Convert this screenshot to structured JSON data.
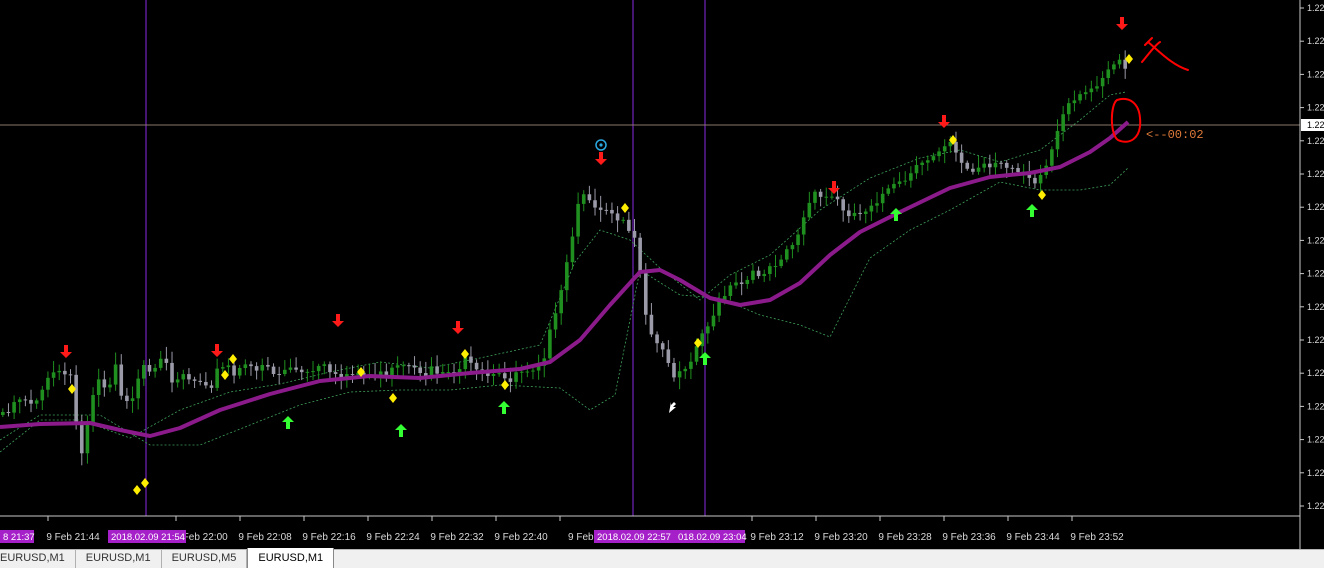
{
  "chart_data": {
    "type": "candlestick",
    "symbol": "EURUSD",
    "timeframe": "M1",
    "x_tick_labels": [
      "9 Feb 21:44",
      "9 Feb 22:00",
      "9 Feb 22:08",
      "9 Feb 22:16",
      "9 Feb 22:24",
      "9 Feb 22:32",
      "9 Feb 22:40",
      "9 Feb 2",
      "9 Feb 23:12",
      "9 Feb 23:20",
      "9 Feb 23:28",
      "9 Feb 23:36",
      "9 Feb 23:44",
      "9 Feb 23:52"
    ],
    "y_tick_labels": [
      "1.22",
      "1.22",
      "1.22",
      "1.22",
      "1.22",
      "1.22",
      "1.22",
      "1.22",
      "1.22",
      "1.22",
      "1.22",
      "1.22",
      "1.22",
      "1.22",
      "1.22",
      "1.22"
    ],
    "current_price_label": "1.22",
    "vertical_line_labels": [
      "8 21:37",
      "2018.02.09 21:54",
      "2018.02.09 22:57",
      "018.02.09 23:04"
    ],
    "countdown_label": "<--00:02",
    "colors": {
      "bull": "#1f8f1f",
      "bear": "#9a9aa8",
      "moving_average": "#8b1a8b",
      "envelope": "#3fa05a",
      "sell_arrow": "#ff1a1a",
      "buy_arrow": "#33ff33",
      "signal_diamond": "#ffee00",
      "vertical_line": "#8a2be2",
      "annotation": "#ff0000"
    },
    "icons": [
      "sell-arrow-icon",
      "buy-arrow-icon",
      "signal-diamond-icon",
      "target-circle-icon",
      "cursor-arrow-icon"
    ]
  },
  "tabs": [
    {
      "label": "EURUSD,M1"
    },
    {
      "label": "EURUSD,M1"
    },
    {
      "label": "EURUSD,M5"
    },
    {
      "label": "EURUSD,M1"
    }
  ],
  "active_tab_index": 3
}
